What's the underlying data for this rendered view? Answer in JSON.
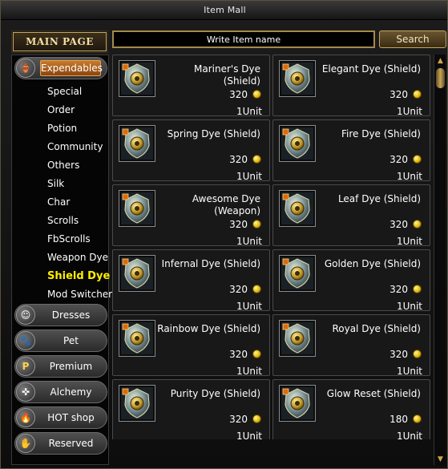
{
  "window": {
    "title": "Item Mall"
  },
  "main_page_label": "MAIN PAGE",
  "search": {
    "placeholder": "Write Item name",
    "button_label": "Search"
  },
  "categories": [
    {
      "label": "Expendables",
      "icon": "potion-icon",
      "active": true
    },
    {
      "label": "Dresses",
      "icon": "character-icon",
      "active": false
    },
    {
      "label": "Pet",
      "icon": "pet-icon",
      "active": false
    },
    {
      "label": "Premium",
      "icon": "premium-p-icon",
      "active": false
    },
    {
      "label": "Alchemy",
      "icon": "alchemy-icon",
      "active": false
    },
    {
      "label": "HOT shop",
      "icon": "fire-icon",
      "active": false
    },
    {
      "label": "Reserved",
      "icon": "hand-icon",
      "active": false
    }
  ],
  "subcategories": [
    "Special",
    "Order",
    "Potion",
    "Community",
    "Others",
    "Silk",
    "Char",
    "Scrolls",
    "FbScrolls",
    "Weapon Dye",
    "Shield Dye",
    "Mod Switcher"
  ],
  "selected_subcategory": "Shield Dye",
  "items": [
    {
      "name": "Mariner's Dye (Shield)",
      "price": "320",
      "unit": "1Unit"
    },
    {
      "name": "Elegant Dye (Shield)",
      "price": "320",
      "unit": "1Unit"
    },
    {
      "name": "Spring Dye (Shield)",
      "price": "320",
      "unit": "1Unit"
    },
    {
      "name": "Fire Dye (Shield)",
      "price": "320",
      "unit": "1Unit"
    },
    {
      "name": "Awesome Dye (Weapon)",
      "price": "320",
      "unit": "1Unit"
    },
    {
      "name": "Leaf Dye (Shield)",
      "price": "320",
      "unit": "1Unit"
    },
    {
      "name": "Infernal Dye (Shield)",
      "price": "320",
      "unit": "1Unit"
    },
    {
      "name": "Golden Dye (Shield)",
      "price": "320",
      "unit": "1Unit"
    },
    {
      "name": "Rainbow Dye (Shield)",
      "price": "320",
      "unit": "1Unit"
    },
    {
      "name": "Royal Dye (Shield)",
      "price": "320",
      "unit": "1Unit"
    },
    {
      "name": "Purity Dye (Shield)",
      "price": "320",
      "unit": "1Unit"
    },
    {
      "name": "Glow Reset (Shield)",
      "price": "180",
      "unit": "1Unit"
    }
  ],
  "colors": {
    "accent_gold": "#c4a65a",
    "selected_text": "#ffee00",
    "active_tab": "#c77a2a"
  }
}
